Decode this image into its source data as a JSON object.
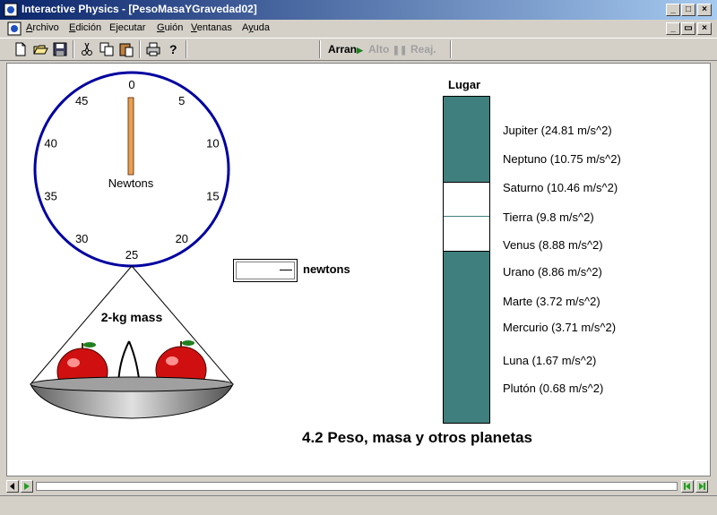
{
  "window": {
    "title": "Interactive Physics - [PesoMasaYGravedad02]",
    "caption_buttons": [
      "_",
      "□",
      "×"
    ],
    "doc_buttons": [
      "_",
      "▭",
      "×"
    ]
  },
  "menu": {
    "items": [
      {
        "label": "Archivo",
        "accel": "A"
      },
      {
        "label": "Edición",
        "accel": "E"
      },
      {
        "label": "Ejecutar",
        "accel": "j"
      },
      {
        "label": "Guión",
        "accel": "G"
      },
      {
        "label": "Ventanas",
        "accel": "V"
      },
      {
        "label": "Ayuda",
        "accel": "y"
      }
    ]
  },
  "toolbar": {
    "icons": [
      "new-icon",
      "open-icon",
      "save-icon",
      "cut-icon",
      "copy-icon",
      "paste-icon",
      "print-icon",
      "help-icon"
    ],
    "run_label": "Arran",
    "stop_label": "Alto",
    "reset_label": "Reaj."
  },
  "scale": {
    "unit_label": "Newtons",
    "ticks": [
      "0",
      "5",
      "10",
      "15",
      "20",
      "25",
      "30",
      "35",
      "40",
      "45"
    ],
    "reading": 0,
    "pan_label": "2-kg mass"
  },
  "meter": {
    "value": "",
    "unit": "newtons"
  },
  "place_selector": {
    "header": "Lugar",
    "selected": "Tierra (9.8 m/s^2)",
    "colors": {
      "track": "#3f7f7d",
      "thumb": "#ffffff"
    },
    "planets": [
      "Jupiter (24.81 m/s^2)",
      "Neptuno (10.75 m/s^2)",
      "Saturno (10.46 m/s^2)",
      "Tierra (9.8 m/s^2)",
      "Venus (8.88 m/s^2)",
      "Urano (8.86 m/s^2)",
      "Marte (3.72 m/s^2)",
      "Mercurio (3.71 m/s^2)",
      "Luna (1.67 m/s^2)",
      "Plutón (0.68 m/s^2)"
    ]
  },
  "caption": "4.2 Peso, masa y otros planetas",
  "colors": {
    "dial_ring": "#0000a0",
    "needle": "#e8a050",
    "apple": "#d01010"
  }
}
